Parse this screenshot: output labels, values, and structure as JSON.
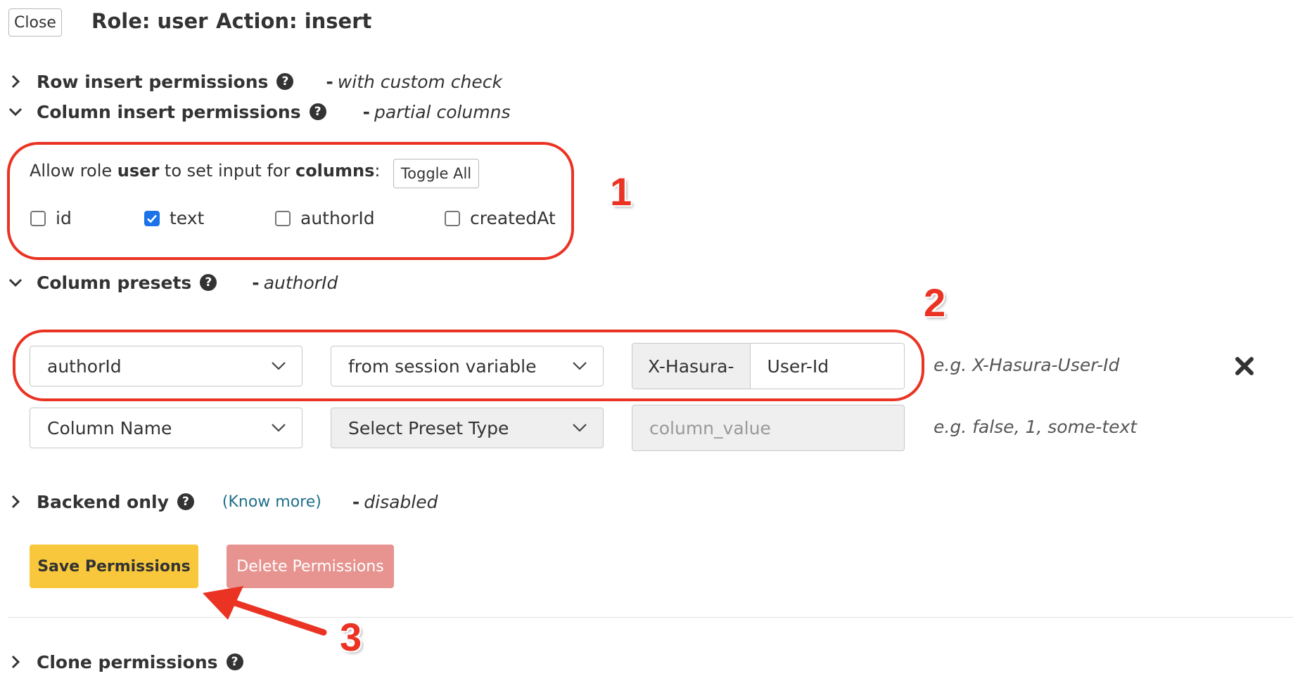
{
  "header": {
    "close_label": "Close",
    "role": "Role: user",
    "action": "Action: insert"
  },
  "sections": {
    "row_insert": {
      "title": "Row insert permissions",
      "status": "with custom check"
    },
    "column_insert": {
      "title": "Column insert permissions",
      "status": "partial columns",
      "allow_prefix": "Allow role",
      "role": "user",
      "allow_middle": "to set input for",
      "columns_word": "columns",
      "allow_suffix": ":",
      "toggle_all_label": "Toggle All",
      "columns": [
        {
          "name": "id",
          "checked": false
        },
        {
          "name": "text",
          "checked": true
        },
        {
          "name": "authorId",
          "checked": false
        },
        {
          "name": "createdAt",
          "checked": false
        }
      ]
    },
    "column_presets": {
      "title": "Column presets",
      "status": "authorId",
      "rows": [
        {
          "column": "authorId",
          "type": "from session variable",
          "prefix": "X-Hasura-",
          "value": "User-Id",
          "hint": "e.g. X-Hasura-User-Id"
        },
        {
          "column": "Column Name",
          "type": "Select Preset Type",
          "placeholder": "column_value",
          "hint": "e.g. false, 1, some-text"
        }
      ]
    },
    "backend_only": {
      "title": "Backend only",
      "know_more": "(Know more)",
      "status": "disabled"
    },
    "clone": {
      "title": "Clone permissions"
    }
  },
  "buttons": {
    "save": "Save Permissions",
    "delete": "Delete Permissions"
  },
  "annotations": [
    "1",
    "2",
    "3"
  ],
  "colors": {
    "annotation_red": "#ea3323",
    "save_yellow": "#f8c73b",
    "delete_pink": "#e79491",
    "checkbox_blue": "#1a73e8",
    "link_blue": "#1f6f8b"
  }
}
